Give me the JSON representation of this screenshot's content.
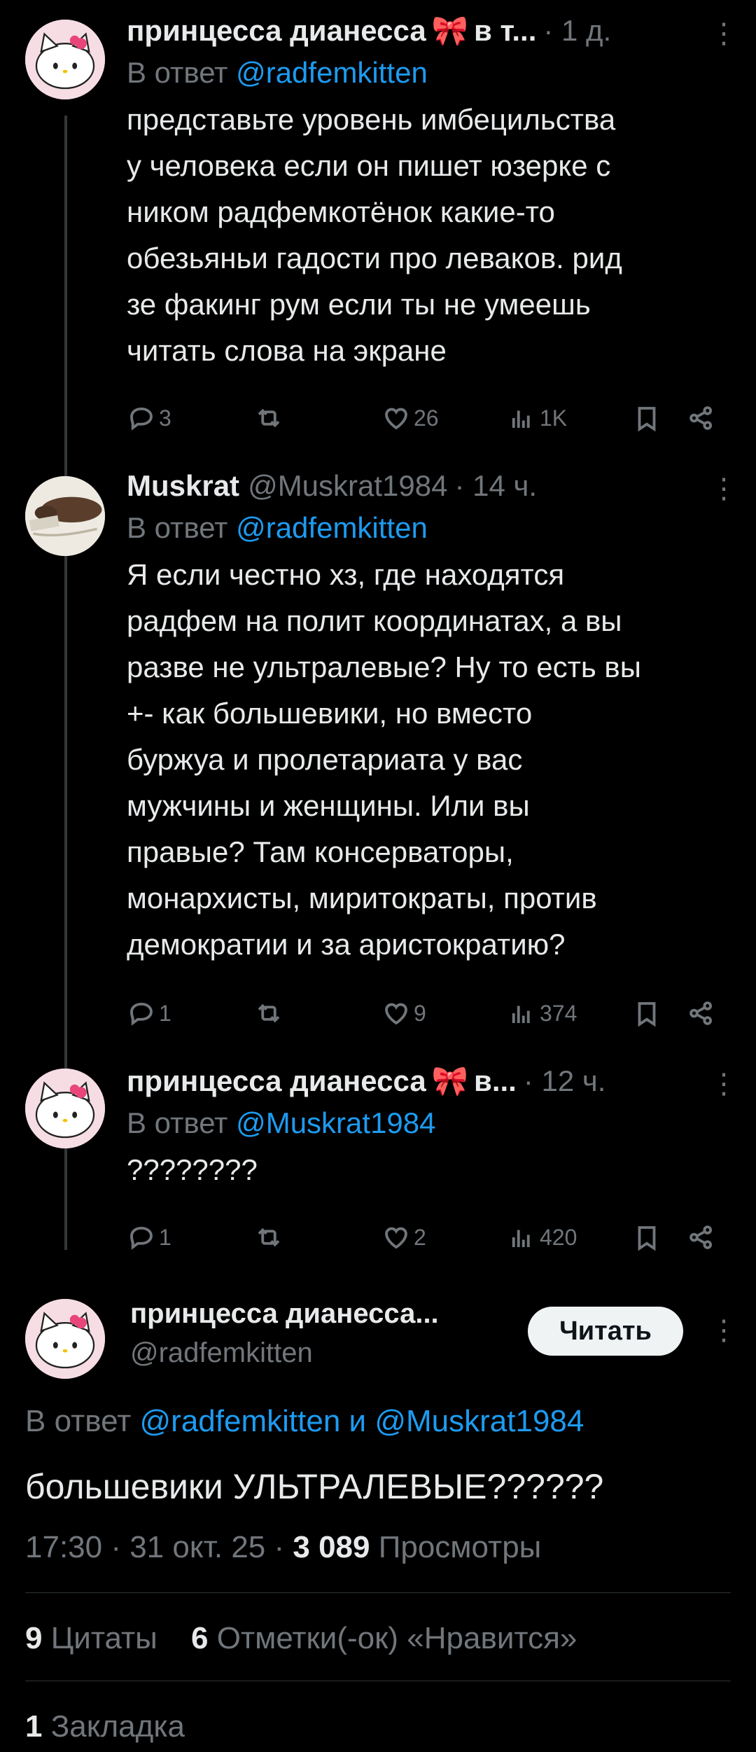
{
  "tweets": [
    {
      "name": "принцесса дианесса",
      "name_suffix": "в т...",
      "handle": "",
      "time": "· 1 д.",
      "reply_prefix": "В ответ",
      "reply_to": "@radfemkitten",
      "text_lines": [
        "представьте уровень имбецильства",
        "у человека если он пишет юзерке с",
        "ником радфемкотёнок какие-то",
        "обезьяньи гадости про леваков. рид",
        "зе факинг рум если ты не умеешь",
        "читать слова на экране"
      ],
      "replies": "3",
      "retweets": "",
      "likes": "26",
      "views": "1K"
    },
    {
      "name": "Muskrat",
      "name_suffix": "",
      "handle": "@Muskrat1984",
      "time": "· 14 ч.",
      "reply_prefix": "В ответ",
      "reply_to": "@radfemkitten",
      "text_lines": [
        "Я если честно хз, где находятся",
        "радфем на полит координатах, а вы",
        "разве не ультралевые? Ну то есть вы",
        "+- как большевики, но вместо",
        "буржуа и пролетариата у вас",
        "мужчины и женщины. Или вы",
        "правые? Там консерваторы,",
        "монархисты, миритократы, против",
        "демократии и за аристократию?"
      ],
      "replies": "1",
      "retweets": "",
      "likes": "9",
      "views": "374"
    },
    {
      "name": "принцесса дианесса",
      "name_suffix": "в...",
      "handle": "",
      "time": "· 12 ч.",
      "reply_prefix": "В ответ",
      "reply_to": "@Muskrat1984",
      "text_lines": [
        "????????"
      ],
      "replies": "1",
      "retweets": "",
      "likes": "2",
      "views": "420"
    }
  ],
  "main": {
    "name": "принцесса дианесса...",
    "handle": "@radfemkitten",
    "follow_label": "Читать",
    "reply_prefix": "В ответ",
    "reply_to_1": "@radfemkitten",
    "reply_and": "и",
    "reply_to_2": "@Muskrat1984",
    "text": "большевики УЛЬТРАЛЕВЫЕ??????",
    "time": "17:30 · 31 окт. 25 ·",
    "views_count": "3 089",
    "views_label": "Просмотры",
    "quotes_count": "9",
    "quotes_label": "Цитаты",
    "likes_count": "6",
    "likes_label": "Отметки(-ок) «Нравится»",
    "bookmarks_count": "1",
    "bookmarks_label": "Закладка"
  },
  "icons": {
    "reply": "reply-icon",
    "retweet": "retweet-icon",
    "like": "heart-icon",
    "views": "views-icon",
    "bookmark": "bookmark-icon",
    "share": "share-icon",
    "more": "more-icon"
  },
  "colors": {
    "background": "#000000",
    "text": "#e7e9ea",
    "muted": "#71767b",
    "link": "#1d9bf0",
    "bow": "#e0245e"
  }
}
